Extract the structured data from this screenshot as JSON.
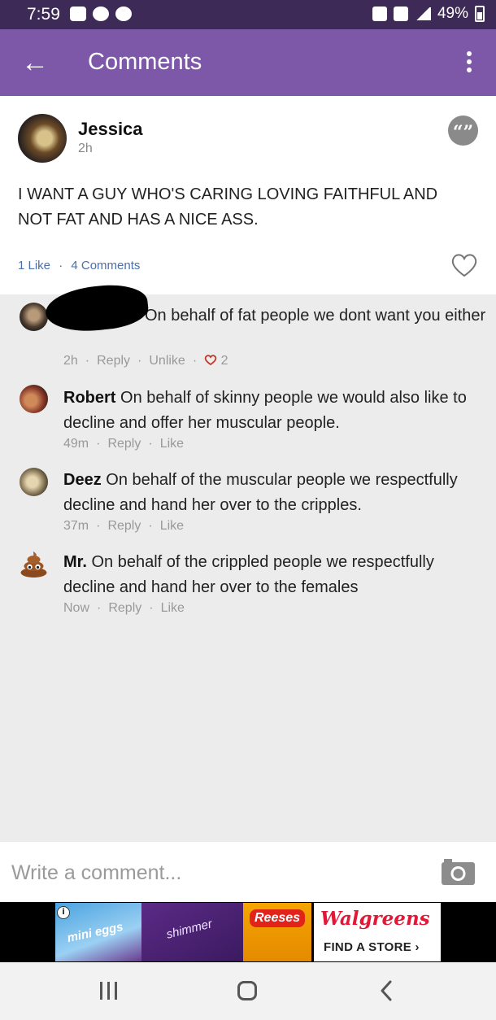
{
  "status_bar": {
    "time": "7:59",
    "battery": "49%",
    "battery_level": 0.49
  },
  "app_bar": {
    "back_icon": "arrow-left-icon",
    "title": "Comments",
    "menu_icon": "more-vertical-icon"
  },
  "post": {
    "author": "Jessica",
    "time": "2h",
    "text": "I WANT A GUY WHO'S CARING LOVING FAITHFUL AND NOT FAT AND HAS A NICE ASS.",
    "likes": "1 Like",
    "dot": "·",
    "comments_count": "4 Comments",
    "quote_glyph": "“”"
  },
  "comments": [
    {
      "author": "",
      "text": "On behalf of fat people we dont want you either",
      "time": "2h",
      "reply": "Reply",
      "action": "Unlike",
      "likes": "2"
    },
    {
      "author": "Robert",
      "text": "On behalf of skinny people we would also like to decline and offer her muscular people.",
      "time": "49m",
      "reply": "Reply",
      "action": "Like"
    },
    {
      "author": "Deez",
      "text": "On behalf of the muscular people we respectfully decline and hand her over to the cripples.",
      "time": "37m",
      "reply": "Reply",
      "action": "Like"
    },
    {
      "author": "Mr.",
      "text": "On behalf of the crippled people we respectfully decline and hand her over to the females",
      "time": "Now",
      "reply": "Reply",
      "action": "Like"
    }
  ],
  "composer": {
    "placeholder": "Write a comment...",
    "camera_icon": "camera-icon"
  },
  "ad": {
    "info": "i",
    "product1": "mini eggs",
    "product2": "shimmer",
    "product3": "Reeses",
    "brand": "Walgreens",
    "cta": "FIND A STORE ›"
  },
  "colors": {
    "app_bar": "#7d57a8",
    "status_bar": "#3e2a56",
    "link": "#4b6fa8",
    "heart": "#c0392b"
  }
}
